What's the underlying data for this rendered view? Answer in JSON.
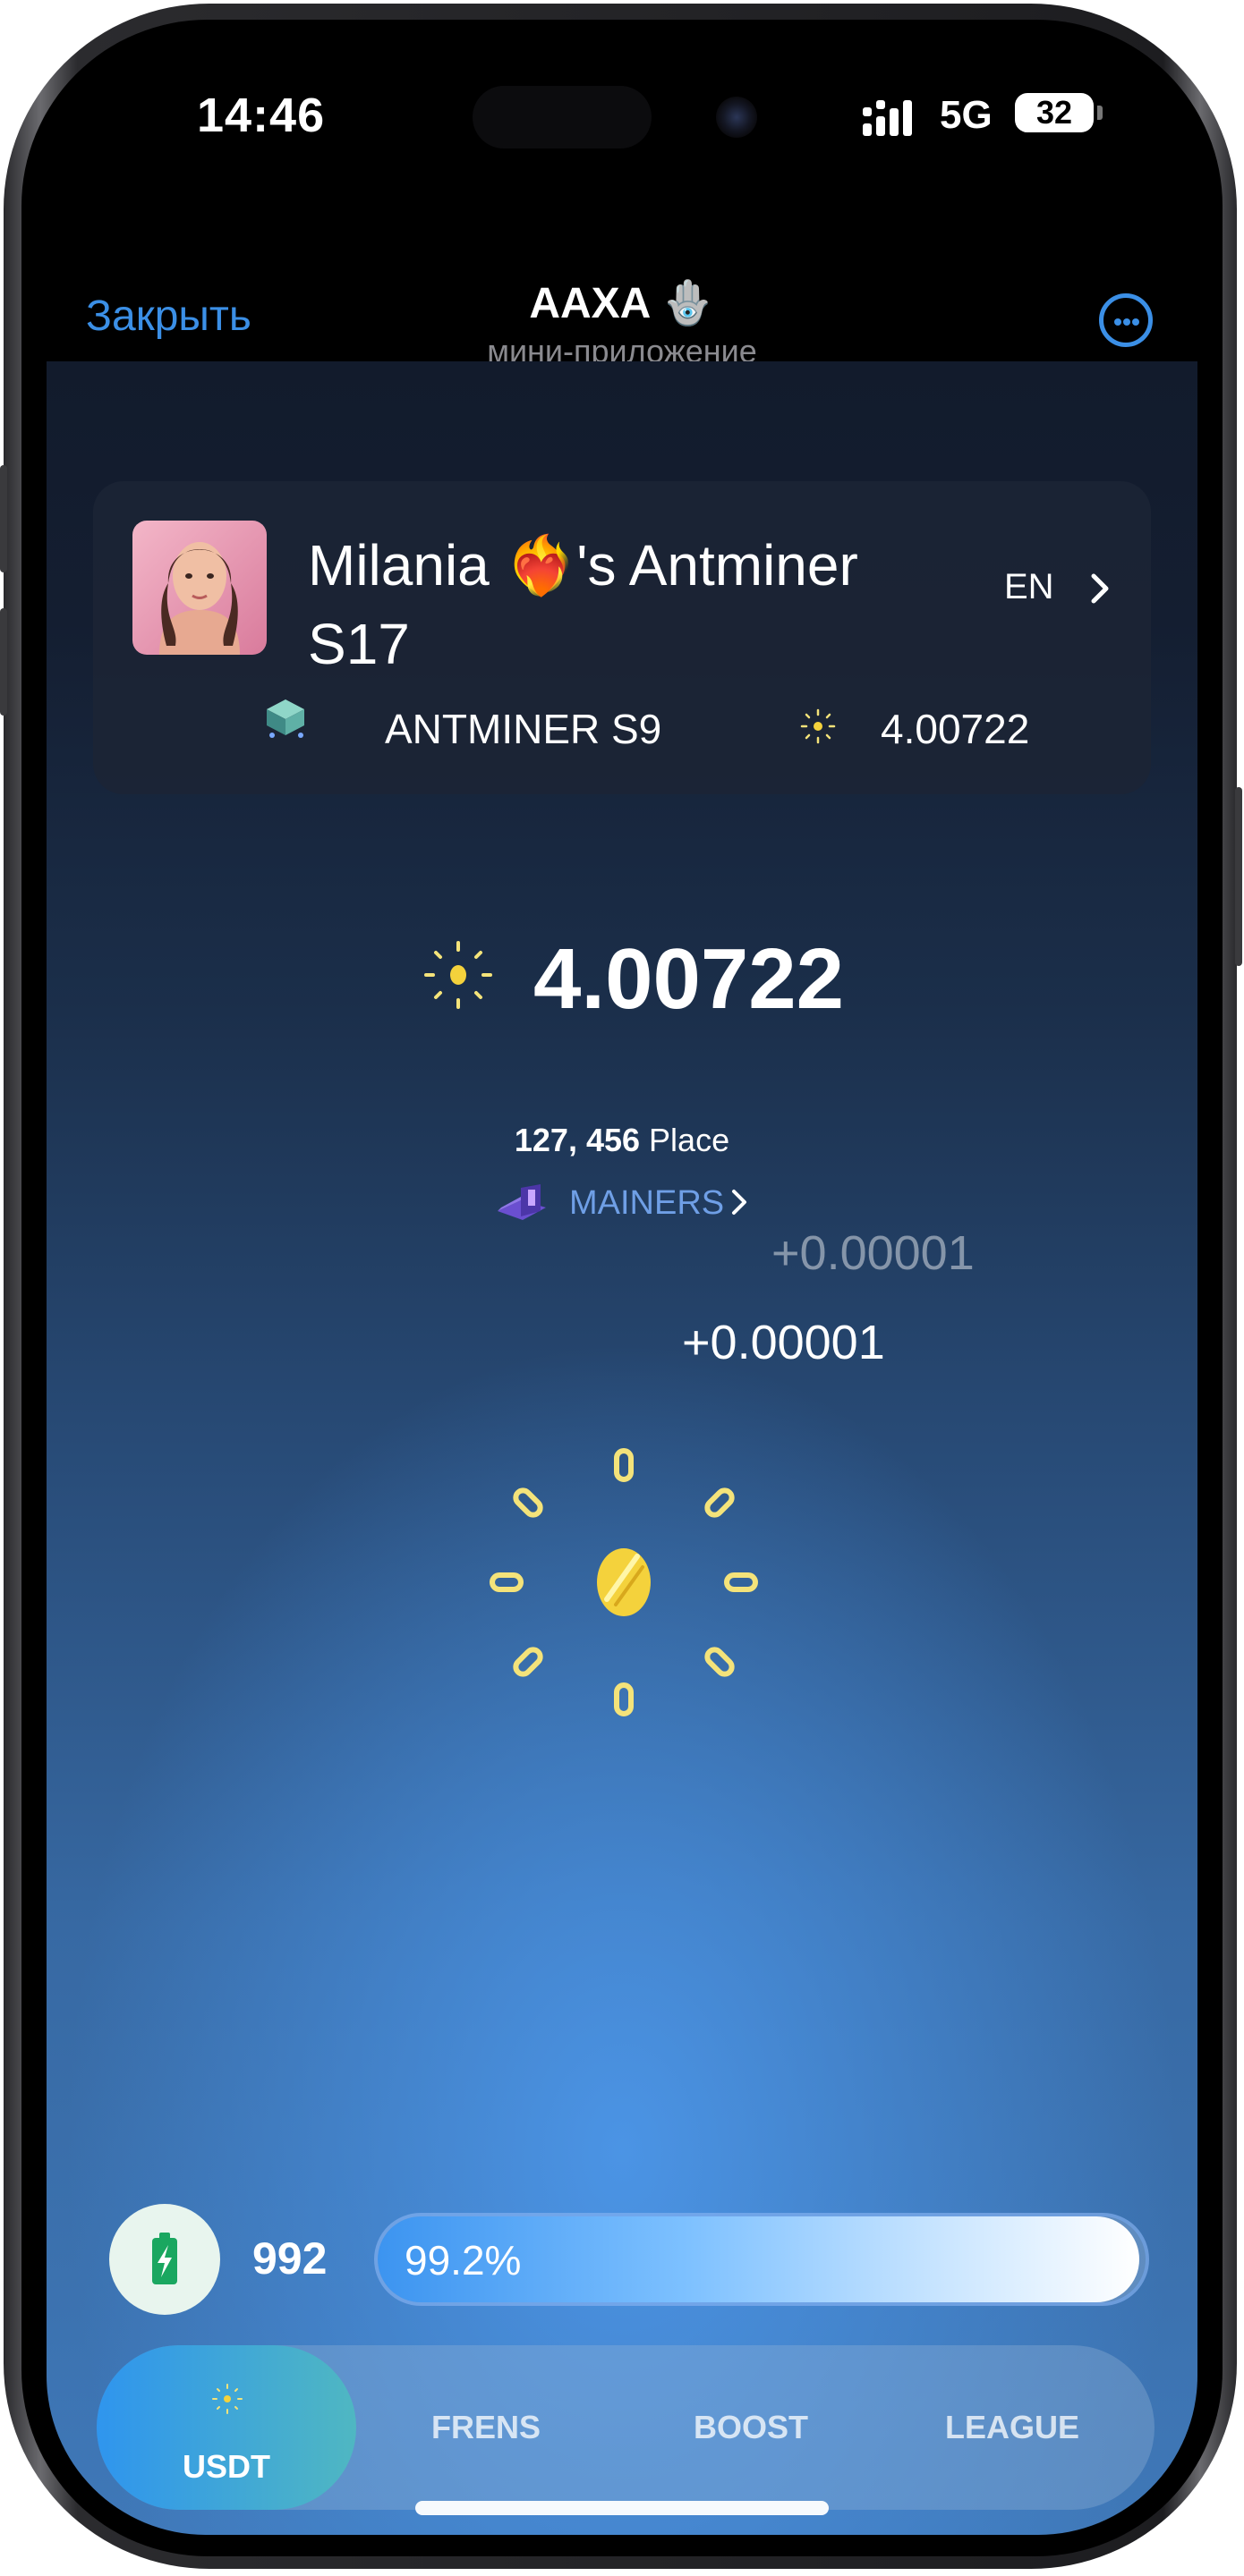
{
  "status_bar": {
    "time": "14:46",
    "network": "5G",
    "battery": "32"
  },
  "header": {
    "close_label": "Закрыть",
    "title": "AAXA 🪬",
    "subtitle": "мини-приложение"
  },
  "profile": {
    "name": "Milania ❤️‍🔥's Antminer S17",
    "language": "EN",
    "miner_label": "ANTMINER S9",
    "balance": "4.00722"
  },
  "main": {
    "balance": "4.00722",
    "place_number": "127, 456",
    "place_label": " Place",
    "mainers_label": "MAINERS",
    "float_gain_1": "+0.00001",
    "float_gain_2": "+0.00001"
  },
  "energy": {
    "count": "992",
    "percent_label": "99.2%",
    "fill_fraction": 0.992
  },
  "tabs": [
    {
      "label": "USDT",
      "active": true
    },
    {
      "label": "FRENS",
      "active": false
    },
    {
      "label": "BOOST",
      "active": false
    },
    {
      "label": "LEAGUE",
      "active": false
    }
  ],
  "colors": {
    "accent": "#3b8fe6",
    "coin": "#f4d23c",
    "ray": "#f4e37a"
  }
}
